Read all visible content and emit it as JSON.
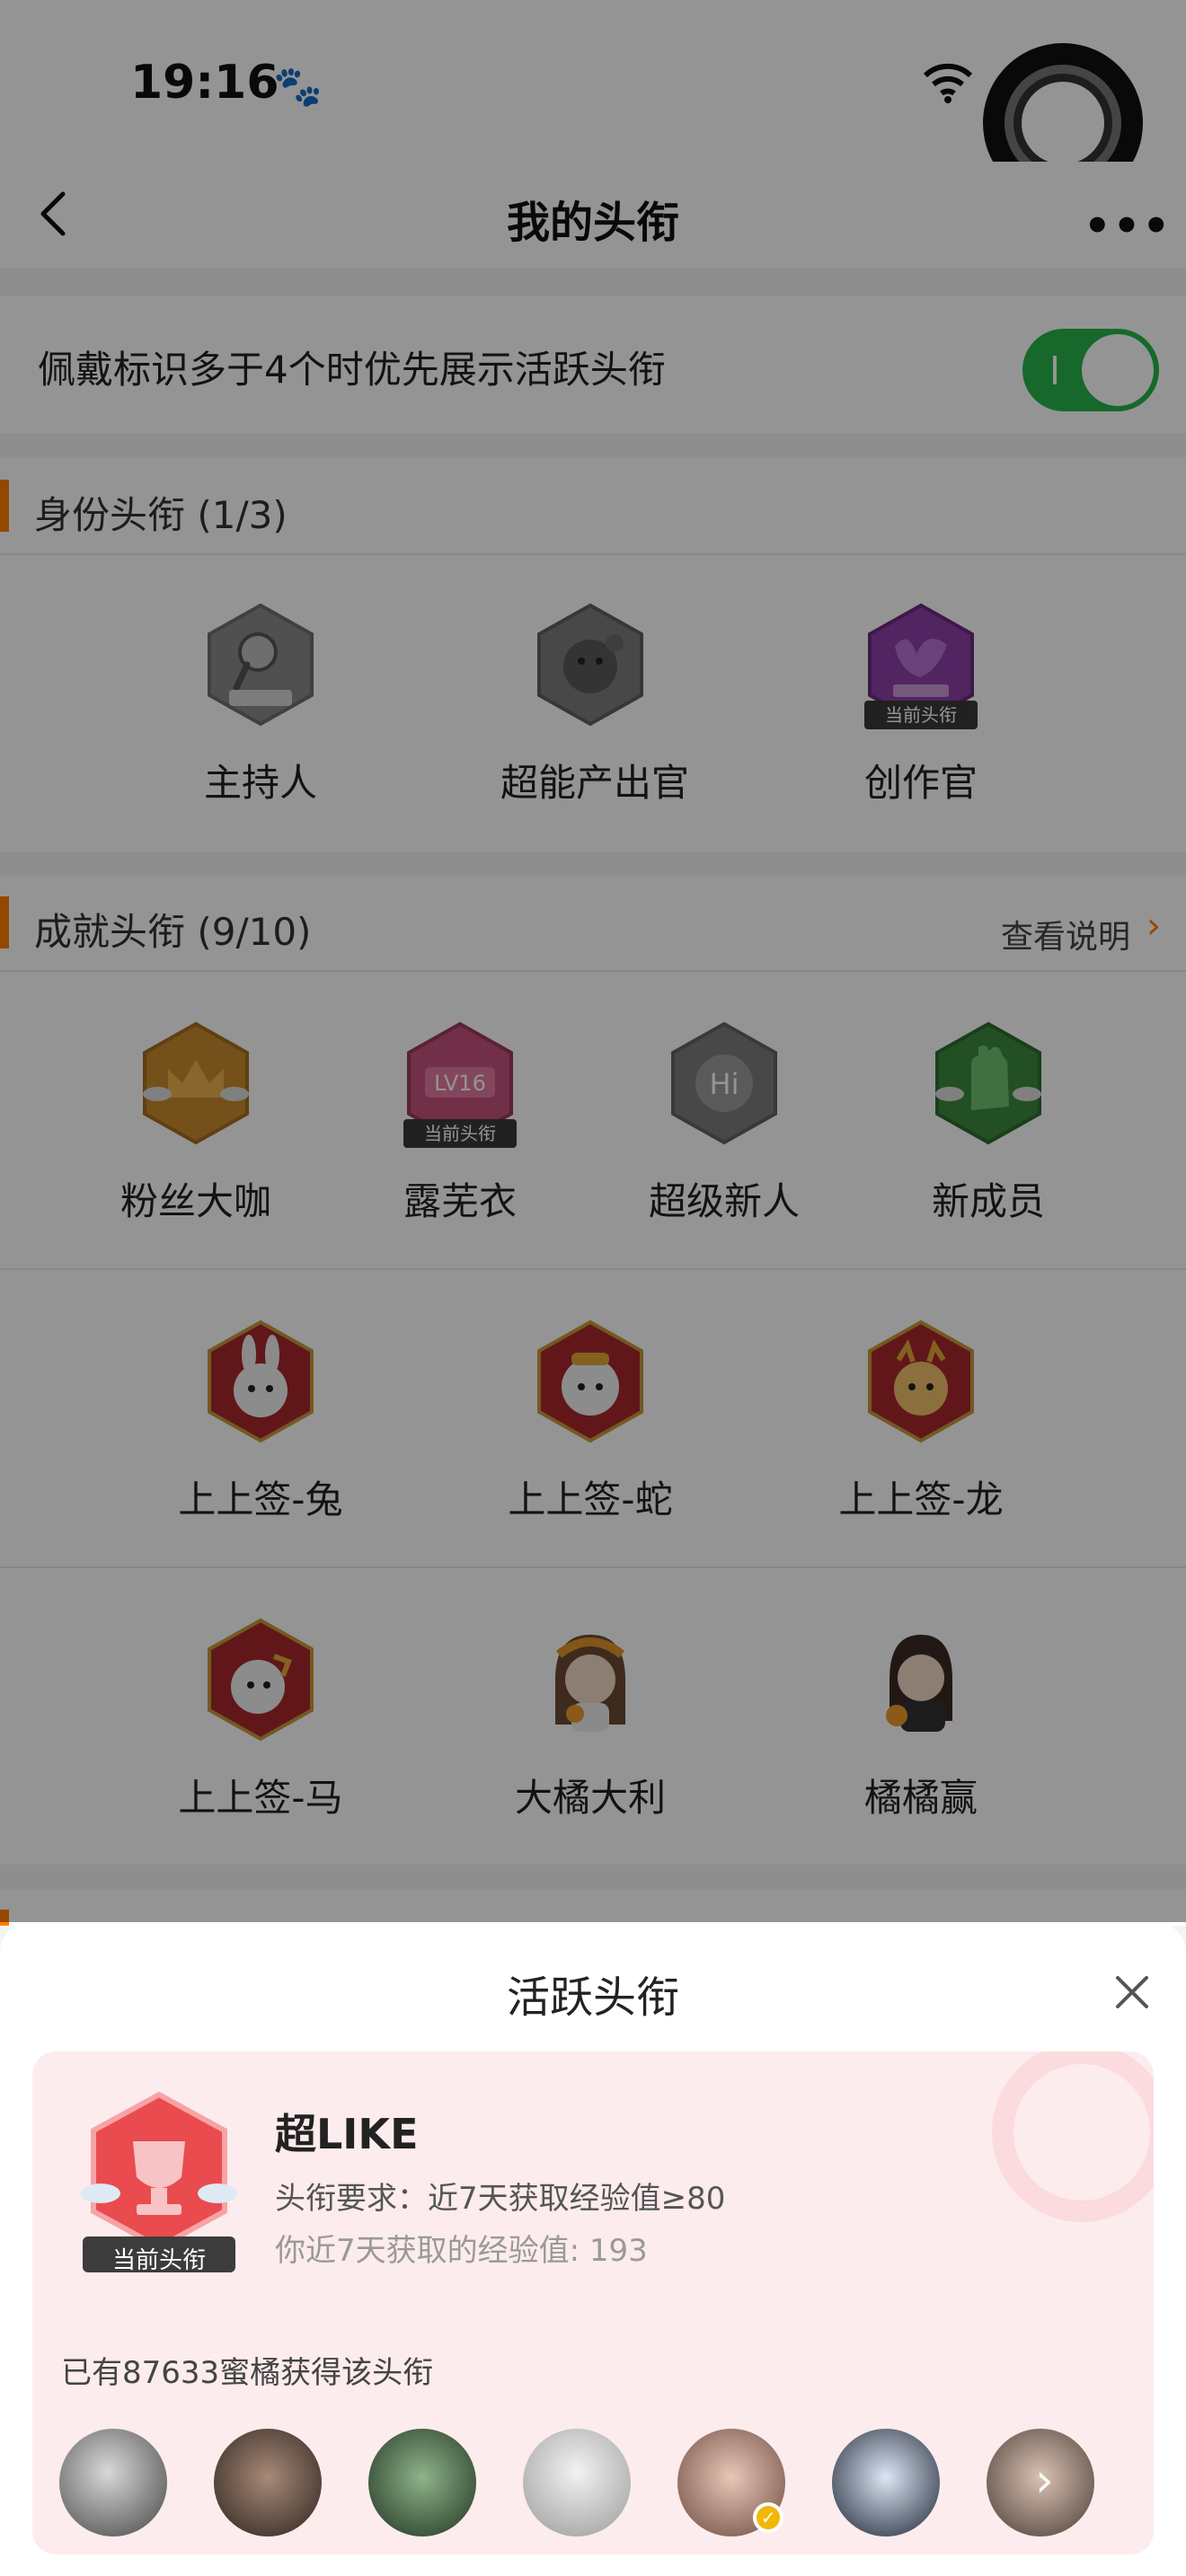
{
  "status_bar": {
    "time": "19:16"
  },
  "nav": {
    "title": "我的头衔"
  },
  "toggle": {
    "label": "佩戴标识多于4个时优先展示活跃头衔",
    "on": true
  },
  "identity": {
    "title": "身份头衔 (1/3)",
    "badges": [
      {
        "label": "主持人",
        "icon": "microphone-hex-icon",
        "current": false
      },
      {
        "label": "超能产出官",
        "icon": "creature-hex-icon",
        "current": false
      },
      {
        "label": "创作官",
        "icon": "creator-hex-icon",
        "current": true,
        "tag": "当前头衔"
      }
    ]
  },
  "achievement": {
    "title": "成就头衔 (9/10)",
    "link": "查看说明",
    "badges": [
      {
        "label": "粉丝大咖",
        "icon": "crown-hex-icon"
      },
      {
        "label": "露芜衣",
        "icon": "lv16-hex-icon",
        "current": true,
        "tag": "当前头衔"
      },
      {
        "label": "超级新人",
        "icon": "hi-hex-icon"
      },
      {
        "label": "新成员",
        "icon": "hand-hex-icon"
      },
      {
        "label": "上上签-兔",
        "icon": "rabbit-hex-icon"
      },
      {
        "label": "上上签-蛇",
        "icon": "snake-hex-icon"
      },
      {
        "label": "上上签-龙",
        "icon": "dragon-hex-icon"
      },
      {
        "label": "上上签-马",
        "icon": "horse-hex-icon"
      },
      {
        "label": "大橘大利",
        "icon": "girl-avatar-icon"
      },
      {
        "label": "橘橘赢",
        "icon": "girl-avatar-icon"
      }
    ]
  },
  "sheet": {
    "title": "活跃头衔",
    "current_tag": "当前头衔",
    "badge_name": "超LIKE",
    "requirement": "头衔要求：近7天获取经验值≥80",
    "exp": "你近7天获取的经验值: 193",
    "count_text": "已有87633蜜橘获得该头衔",
    "avatars": 7
  },
  "colors": {
    "accent": "#ff7b00",
    "switch_on": "#28b34a",
    "card_bg": "#fdeced"
  }
}
